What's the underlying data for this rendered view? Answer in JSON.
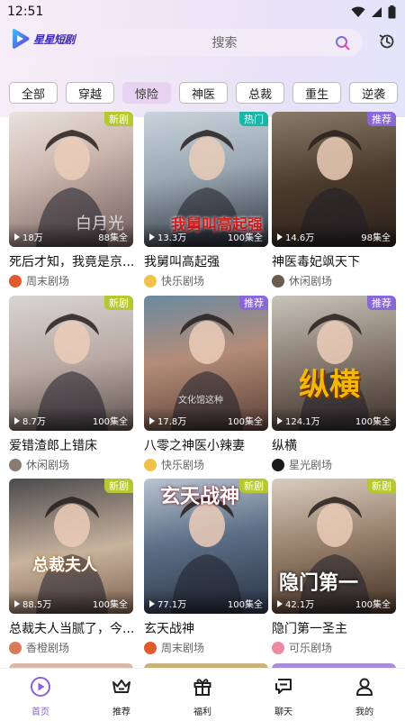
{
  "status": {
    "time": "12:51"
  },
  "header": {
    "logo_text": "星星短剧",
    "search_placeholder": "搜索"
  },
  "tabs": [
    "全部",
    "穿越",
    "惊险",
    "神医",
    "总裁",
    "重生",
    "逆袭"
  ],
  "active_tab": 2,
  "cards": [
    {
      "title": "死后才知，我竟是京...",
      "views": "18万",
      "episodes": "88集全",
      "badge": "新剧",
      "badge_type": "new",
      "source": "周末剧场",
      "poster_text": "白月光"
    },
    {
      "title": "我舅叫高起强",
      "views": "13.3万",
      "episodes": "100集全",
      "badge": "热门",
      "badge_type": "hot",
      "source": "快乐剧场",
      "poster_text": "我舅叫高起强"
    },
    {
      "title": "神医毒妃飒天下",
      "views": "14.6万",
      "episodes": "98集全",
      "badge": "推荐",
      "badge_type": "rec",
      "source": "休闲剧场",
      "poster_text": ""
    },
    {
      "title": "爱错渣郎上错床",
      "views": "8.7万",
      "episodes": "100集全",
      "badge": "新剧",
      "badge_type": "new",
      "source": "休闲剧场",
      "poster_text": ""
    },
    {
      "title": "八零之神医小辣妻",
      "views": "17.8万",
      "episodes": "100集全",
      "badge": "推荐",
      "badge_type": "rec",
      "source": "快乐剧场",
      "poster_text": "文化馆这种"
    },
    {
      "title": "纵横",
      "views": "124.1万",
      "episodes": "100集全",
      "badge": "推荐",
      "badge_type": "rec",
      "source": "星光剧场",
      "poster_text": "纵横"
    },
    {
      "title": "总裁夫人当腻了，今...",
      "views": "88.5万",
      "episodes": "100集全",
      "badge": "新剧",
      "badge_type": "new",
      "source": "香橙剧场",
      "poster_text": "总裁夫人"
    },
    {
      "title": "玄天战神",
      "views": "77.1万",
      "episodes": "100集全",
      "badge": "新剧",
      "badge_type": "new",
      "source": "周末剧场",
      "poster_text": "玄天战神"
    },
    {
      "title": "隐门第一圣主",
      "views": "42.1万",
      "episodes": "100集全",
      "badge": "新剧",
      "badge_type": "new",
      "source": "可乐剧场",
      "poster_text": "隐门第一"
    }
  ],
  "nav": [
    {
      "label": "首页",
      "icon": "home-play-icon",
      "active": true
    },
    {
      "label": "推荐",
      "icon": "crown-icon",
      "active": false
    },
    {
      "label": "福利",
      "icon": "gift-icon",
      "active": false
    },
    {
      "label": "聊天",
      "icon": "chat-icon",
      "active": false
    },
    {
      "label": "我的",
      "icon": "user-icon",
      "active": false
    }
  ],
  "colors": {
    "accent": "#8a5fe0",
    "badge_new": "#b6c82f",
    "badge_hot": "#1bb6a6",
    "badge_rec": "#8a67d9",
    "active_tab_bg": "#e8d2f1"
  }
}
